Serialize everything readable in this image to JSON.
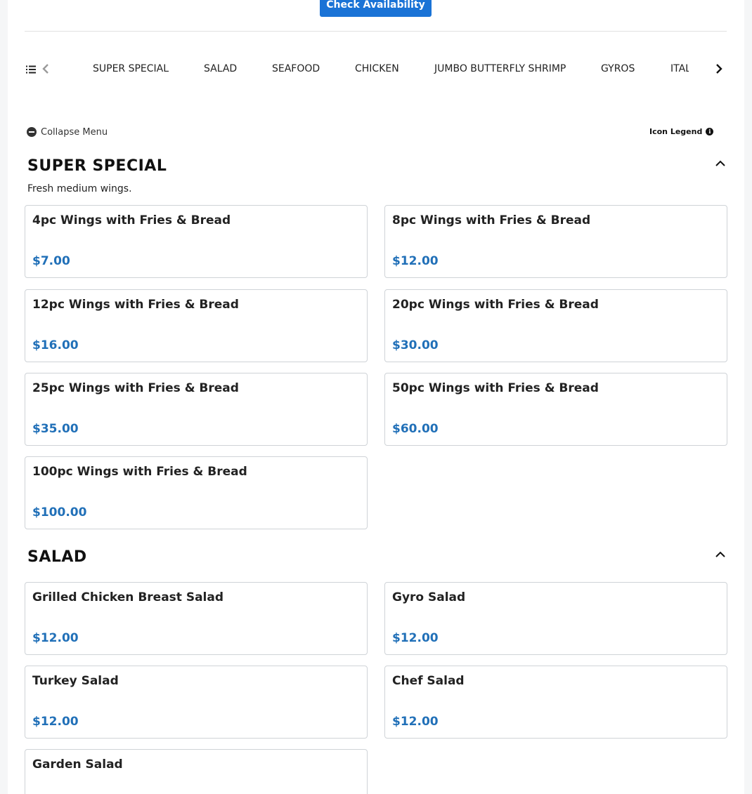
{
  "header": {
    "check_availability": "Check Availability"
  },
  "category_nav": {
    "items": [
      "SUPER SPECIAL",
      "SALAD",
      "SEAFOOD",
      "CHICKEN",
      "JUMBO BUTTERFLY SHRIMP",
      "GYROS",
      "ITALIAN"
    ]
  },
  "controls": {
    "collapse_menu": "Collapse Menu",
    "icon_legend": "Icon Legend"
  },
  "sections": [
    {
      "title": "SUPER SPECIAL",
      "description": "Fresh medium wings.",
      "items": [
        {
          "name": "4pc Wings with Fries & Bread",
          "price": "$7.00"
        },
        {
          "name": "8pc Wings with Fries & Bread",
          "price": "$12.00"
        },
        {
          "name": "12pc Wings with Fries & Bread",
          "price": "$16.00"
        },
        {
          "name": "20pc Wings with Fries & Bread",
          "price": "$30.00"
        },
        {
          "name": "25pc Wings with Fries & Bread",
          "price": "$35.00"
        },
        {
          "name": "50pc Wings with Fries & Bread",
          "price": "$60.00"
        },
        {
          "name": "100pc Wings with Fries & Bread",
          "price": "$100.00"
        }
      ]
    },
    {
      "title": "SALAD",
      "items": [
        {
          "name": "Grilled Chicken Breast Salad",
          "price": "$12.00"
        },
        {
          "name": "Gyro Salad",
          "price": "$12.00"
        },
        {
          "name": "Turkey Salad",
          "price": "$12.00"
        },
        {
          "name": "Chef Salad",
          "price": "$12.00"
        },
        {
          "name": "Garden Salad",
          "price": ""
        }
      ]
    }
  ],
  "colors": {
    "primary_button": "#1a73d6",
    "price": "#2170b8",
    "card_border": "#cfd3d7"
  }
}
